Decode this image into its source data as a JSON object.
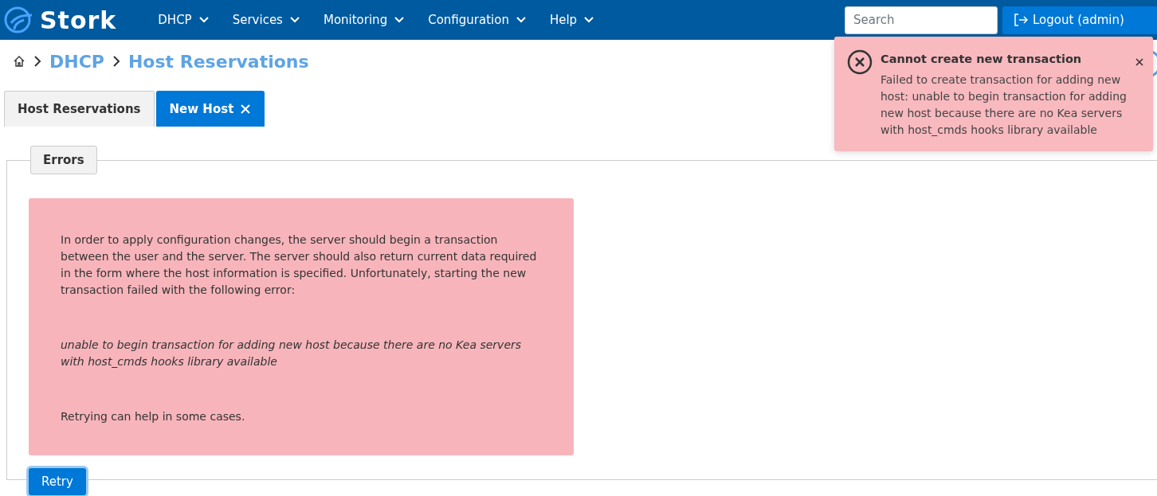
{
  "navbar": {
    "logo": "Stork",
    "menu": [
      {
        "label": "DHCP"
      },
      {
        "label": "Services"
      },
      {
        "label": "Monitoring"
      },
      {
        "label": "Configuration"
      },
      {
        "label": "Help"
      }
    ],
    "search": {
      "placeholder": "Search"
    },
    "logout": "Logout (admin)"
  },
  "breadcrumb": [
    "DHCP",
    "Host Reservations"
  ],
  "tabs": [
    {
      "label": "Host Reservations",
      "selected": false,
      "closable": false
    },
    {
      "label": "New Host",
      "selected": true,
      "closable": true
    }
  ],
  "panel": {
    "legend": "Errors",
    "paragraphs": [
      {
        "kind": "plain",
        "text": "In order to apply configuration changes, the server should begin a transaction between the user and the server. The server should also return current data required in the form where the host information is specified. Unfortunately, starting the new transaction failed with the following error:"
      },
      {
        "kind": "error",
        "text": "unable to begin transaction for adding new host because there are no Kea servers with host_cmds hooks library available"
      },
      {
        "kind": "plain",
        "text": "Retrying can help in some cases."
      }
    ],
    "button": "Retry"
  },
  "toast": {
    "title": "Cannot create new transaction",
    "message": "Failed to create transaction for adding new host: unable to begin transaction for adding new host because there are no Kea servers with host_cmds hooks library available"
  }
}
